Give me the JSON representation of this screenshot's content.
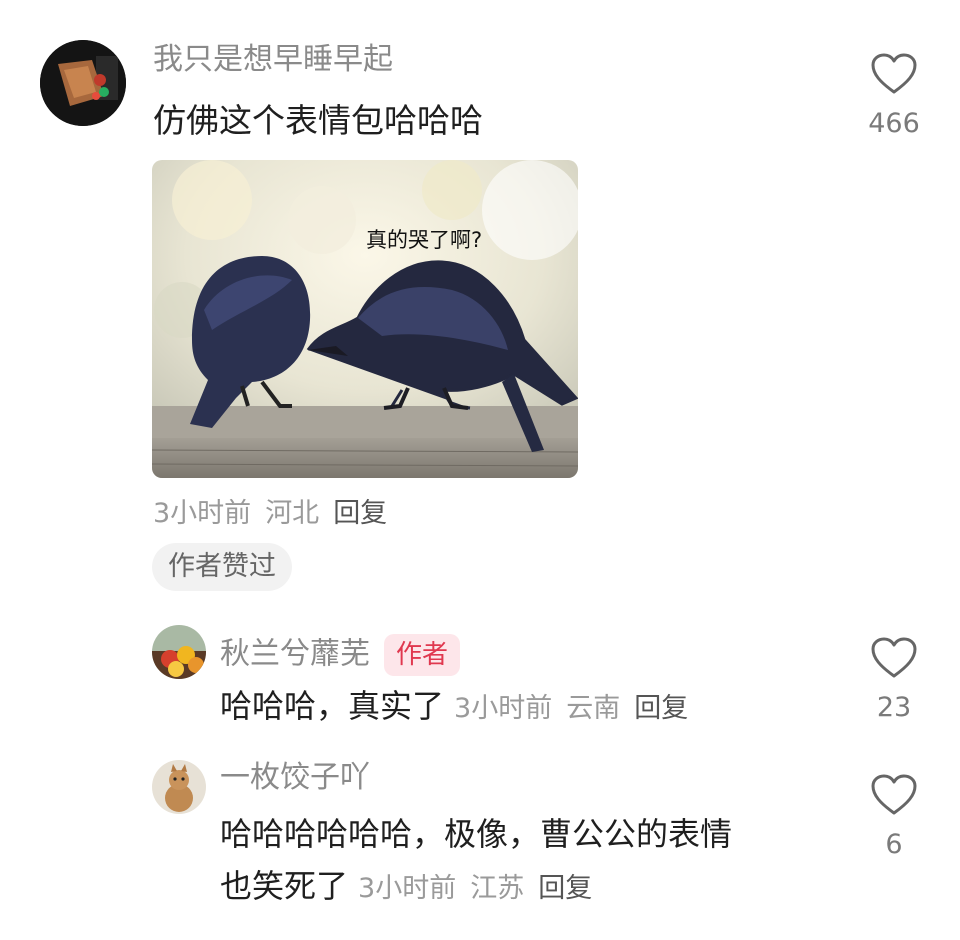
{
  "main_comment": {
    "username": "我只是想早睡早起",
    "text": "仿佛这个表情包哈哈哈",
    "likes": "466",
    "meme_caption": "真的哭了啊?",
    "time": "3小时前",
    "location": "河北",
    "reply_label": "回复",
    "author_liked_label": "作者赞过",
    "icon": "heart-outline-icon"
  },
  "replies": [
    {
      "username": "秋兰兮蘼芜",
      "badge": "作者",
      "text": "哈哈哈，真实了",
      "time": "3小时前",
      "location": "云南",
      "reply_label": "回复",
      "likes": "23"
    },
    {
      "username": "一枚饺子吖",
      "text_line1": "哈哈哈哈哈哈，极像，曹公公的表情",
      "text_line2": "也笑死了",
      "time": "3小时前",
      "location": "江苏",
      "reply_label": "回复",
      "likes": "6"
    }
  ],
  "colors": {
    "username": "#8a8a8a",
    "badge_bg": "#fde6ea",
    "badge_text": "#e0384f"
  }
}
